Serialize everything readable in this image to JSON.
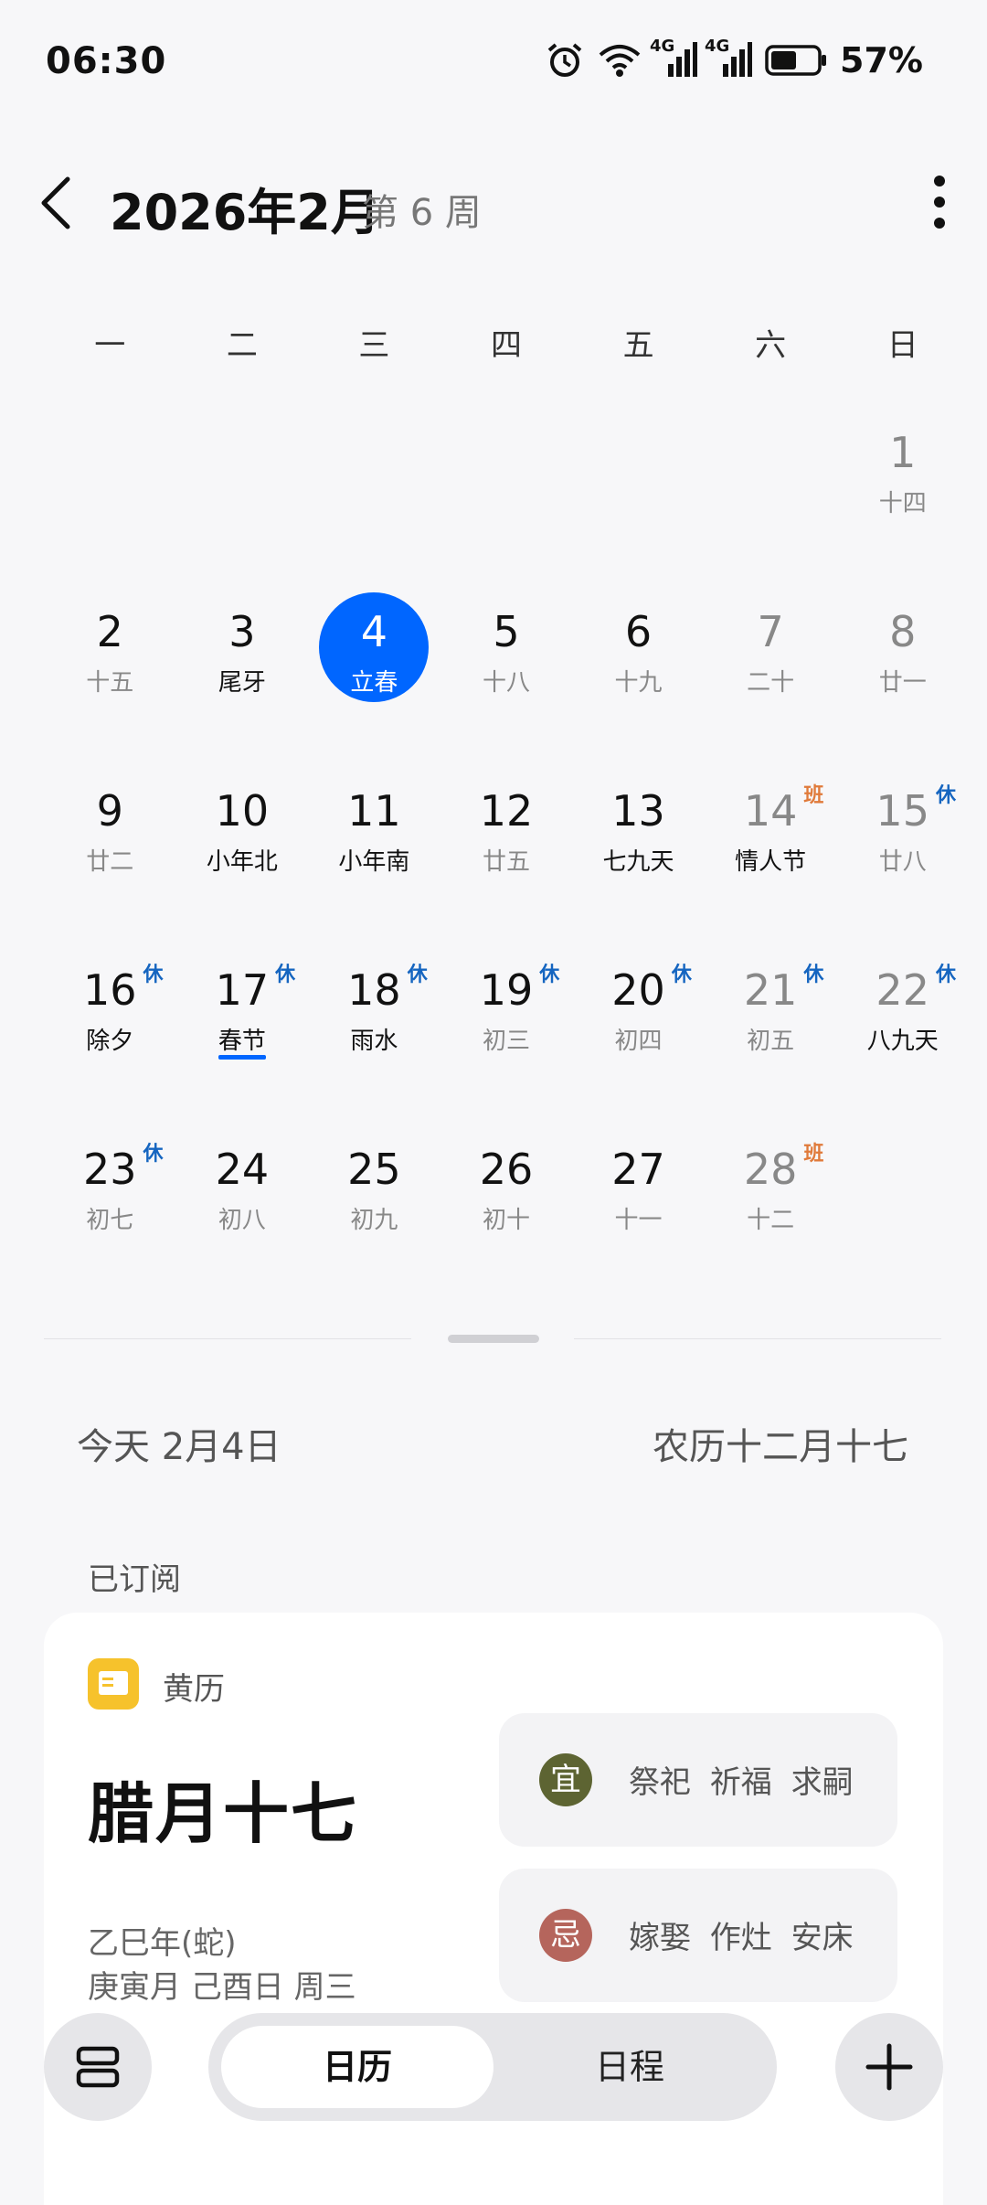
{
  "status": {
    "time": "06:30",
    "battery": "57%",
    "net1": "4G",
    "net2": "4G"
  },
  "header": {
    "title": "2026年2月",
    "week": "第 6 周"
  },
  "weekdays": [
    "一",
    "二",
    "三",
    "四",
    "五",
    "六",
    "日"
  ],
  "calendar": {
    "leading_blanks": 6,
    "days": [
      {
        "n": "1",
        "s": "十四"
      },
      {
        "n": "2",
        "s": "十五"
      },
      {
        "n": "3",
        "s": "尾牙",
        "hl": true
      },
      {
        "n": "4",
        "s": "立春",
        "today": true
      },
      {
        "n": "5",
        "s": "十八"
      },
      {
        "n": "6",
        "s": "十九"
      },
      {
        "n": "7",
        "s": "二十"
      },
      {
        "n": "8",
        "s": "廿一"
      },
      {
        "n": "9",
        "s": "廿二"
      },
      {
        "n": "10",
        "s": "小年北",
        "hl": true
      },
      {
        "n": "11",
        "s": "小年南",
        "hl": true
      },
      {
        "n": "12",
        "s": "廿五"
      },
      {
        "n": "13",
        "s": "七九天",
        "hl": true
      },
      {
        "n": "14",
        "s": "情人节",
        "hl": true,
        "tag": "班"
      },
      {
        "n": "15",
        "s": "廿八",
        "tag": "休"
      },
      {
        "n": "16",
        "s": "除夕",
        "hl": true,
        "tag": "休"
      },
      {
        "n": "17",
        "s": "春节",
        "hl": true,
        "tag": "休",
        "underline": true
      },
      {
        "n": "18",
        "s": "雨水",
        "hl": true,
        "tag": "休"
      },
      {
        "n": "19",
        "s": "初三",
        "tag": "休"
      },
      {
        "n": "20",
        "s": "初四",
        "tag": "休"
      },
      {
        "n": "21",
        "s": "初五",
        "tag": "休"
      },
      {
        "n": "22",
        "s": "八九天",
        "hl": true,
        "tag": "休"
      },
      {
        "n": "23",
        "s": "初七",
        "tag": "休"
      },
      {
        "n": "24",
        "s": "初八"
      },
      {
        "n": "25",
        "s": "初九"
      },
      {
        "n": "26",
        "s": "初十"
      },
      {
        "n": "27",
        "s": "十一"
      },
      {
        "n": "28",
        "s": "十二",
        "tag": "班"
      }
    ]
  },
  "today_bar": {
    "today": "今天  2月4日",
    "lunar": "农历十二月十七"
  },
  "subscribed": "已订阅",
  "almanac": {
    "name": "黄历",
    "lunar_date": "腊月十七",
    "year_line": "乙巳年(蛇)",
    "day_line": "庚寅月 己酉日 周三",
    "yi_label": "宜",
    "yi_items": "祭祀 祈福 求嗣",
    "ji_label": "忌",
    "ji_items": "嫁娶 作灶 安床"
  },
  "tabs": {
    "calendar": "日历",
    "schedule": "日程"
  },
  "colors": {
    "accent": "#0066ff",
    "rest": "#1565c0",
    "work": "#e07a3a"
  }
}
